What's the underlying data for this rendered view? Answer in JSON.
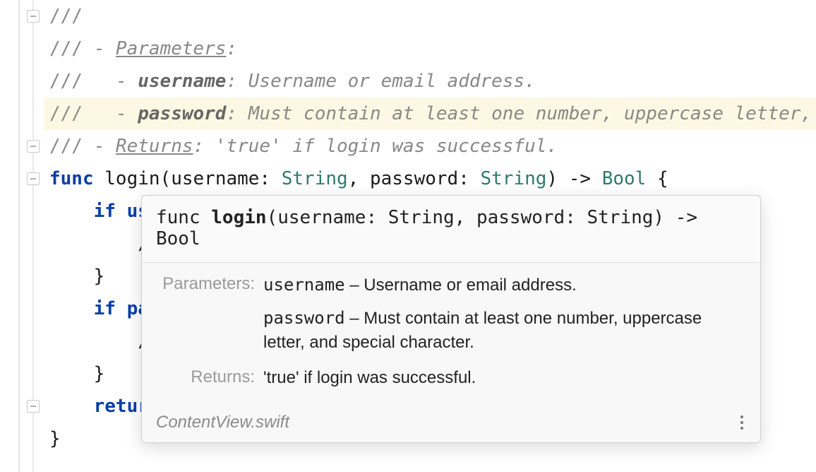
{
  "comments": {
    "l1": "///",
    "l2_prefix": "/// - ",
    "l2_label": "Parameters",
    "l2_colon": ":",
    "l3_prefix": "///   - ",
    "l3_name": "username",
    "l3_rest": ": Username or email address.",
    "l4_prefix": "///   - ",
    "l4_name": "password",
    "l4_rest": ": Must contain at least one number, uppercase letter,",
    "l5_prefix": "/// - ",
    "l5_label": "Returns",
    "l5_rest": ": 'true' if login was successful."
  },
  "code": {
    "func": "func",
    "name": " login",
    "sig_open": "(username: ",
    "string1": "String",
    "sig_mid": ", password: ",
    "string2": "String",
    "sig_close": ") -> ",
    "bool": "Bool",
    "brace": " {",
    "if1": "    if us",
    "slash1": "        /",
    "brace_close1": "    }",
    "if2": "    if pa",
    "slash2": "        /",
    "brace_close2": "    }",
    "retur": "    retur",
    "end": "}"
  },
  "popup": {
    "sig_func": "func ",
    "sig_name": "login",
    "sig_rest": "(username: String, password: String) -> Bool",
    "parameters_label": "Parameters:",
    "param1_name": "username",
    "param1_desc": " – Username or email address.",
    "param2_name": "password",
    "param2_desc": " – Must contain at least one number, uppercase letter, and special character.",
    "returns_label": "Returns:",
    "returns_value": "'true' if login was successful.",
    "source_file": "ContentView.swift"
  }
}
